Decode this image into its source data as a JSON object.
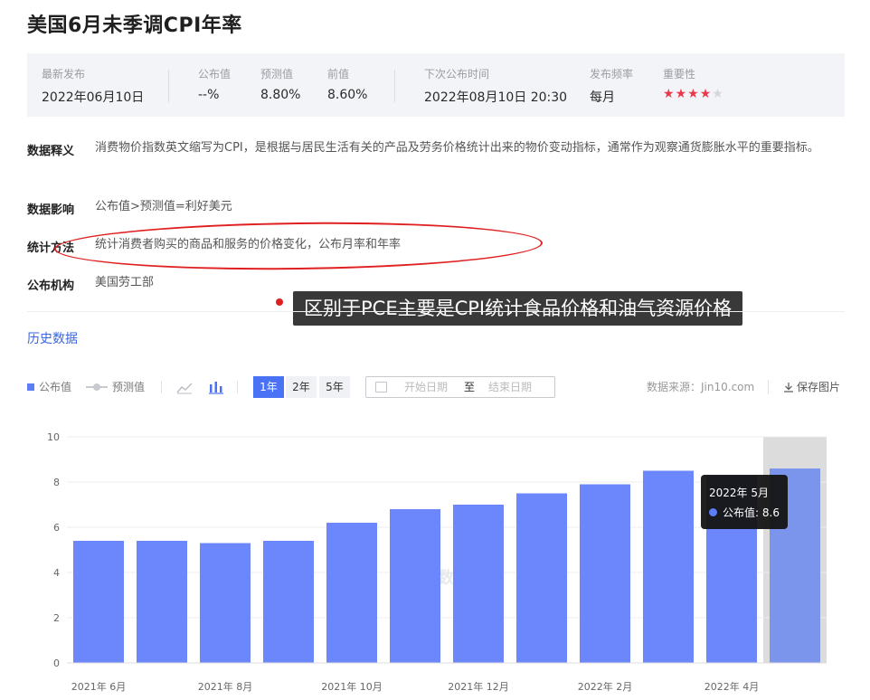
{
  "page": {
    "title": "美国6月未季调CPI年率"
  },
  "info": {
    "latest_label": "最新发布",
    "latest_value": "2022年06月10日",
    "actual_label": "公布值",
    "actual_value": "--%",
    "forecast_label": "预测值",
    "forecast_value": "8.80%",
    "previous_label": "前值",
    "previous_value": "8.60%",
    "next_label": "下次公布时间",
    "next_value": "2022年08月10日 20:30",
    "freq_label": "发布频率",
    "freq_value": "每月",
    "importance_label": "重要性",
    "importance_stars": 4,
    "importance_max": 5
  },
  "details": {
    "definition_label": "数据释义",
    "definition_text": "消费物价指数英文缩写为CPI，是根据与居民生活有关的产品及劳务价格统计出来的物价变动指标，通常作为观察通货膨胀水平的重要指标。",
    "impact_label": "数据影响",
    "impact_text": "公布值>预测值=利好美元",
    "method_label": "统计方法",
    "method_text": "统计消费者购买的商品和服务的价格变化，公布月率和年率",
    "agency_label": "公布机构",
    "agency_text": "美国劳工部"
  },
  "annotation": {
    "text": "区别于PCE主要是CPI统计食品价格和油气资源价格",
    "color": "#e02020"
  },
  "history": {
    "link_label": "历史数据"
  },
  "toolbar": {
    "legend_actual": "公布值",
    "legend_forecast": "预测值",
    "range_1y": "1年",
    "range_2y": "2年",
    "range_5y": "5年",
    "active_range": "1年",
    "start_placeholder": "开始日期",
    "to_label": "至",
    "end_placeholder": "结束日期",
    "source": "数据来源：Jin10.com",
    "save_label": "保存图片"
  },
  "tooltip": {
    "title": "2022年 5月",
    "series": "公布值",
    "value": "8.6"
  },
  "watermark": "金十数据",
  "colors": {
    "bar": "#6b87fb",
    "bar_highlight": "#7c95ec",
    "accent": "#4a72f5",
    "highlight_bg": "#dcdcdc"
  },
  "chart_data": {
    "type": "bar",
    "categories": [
      "2021年 6月",
      "2021年 7月",
      "2021年 8月",
      "2021年 9月",
      "2021年 10月",
      "2021年 11月",
      "2021年 12月",
      "2022年 1月",
      "2022年 2月",
      "2022年 3月",
      "2022年 4月",
      "2022年 5月"
    ],
    "tick_labels": [
      "2021年 6月",
      "",
      "2021年 8月",
      "",
      "2021年 10月",
      "",
      "2021年 12月",
      "",
      "2022年 2月",
      "",
      "2022年 4月",
      ""
    ],
    "series": [
      {
        "name": "公布值",
        "values": [
          5.4,
          5.4,
          5.3,
          5.4,
          6.2,
          6.8,
          7.0,
          7.5,
          7.9,
          8.5,
          8.3,
          8.6
        ]
      }
    ],
    "ylim": [
      0,
      10
    ],
    "yticks": [
      0,
      2,
      4,
      6,
      8,
      10
    ],
    "grid": true,
    "highlight_category": "2022年 5月"
  }
}
